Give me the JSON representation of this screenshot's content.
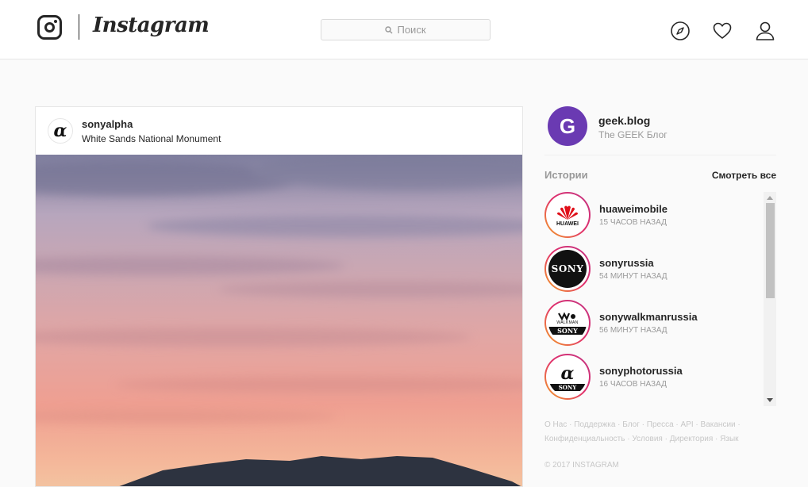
{
  "header": {
    "wordmark": "Instagram",
    "search_placeholder": "Поиск",
    "icons": [
      "instagram-logo-icon",
      "search-icon",
      "explore-compass-icon",
      "heart-icon",
      "profile-icon"
    ]
  },
  "post": {
    "username": "sonyalpha",
    "location": "White Sands National Monument",
    "avatar_glyph": "α"
  },
  "sidebar": {
    "me": {
      "initial": "G",
      "username": "geek.blog",
      "full_name": "The GEEK Блог"
    },
    "stories_title": "Истории",
    "see_all": "Смотреть все",
    "stories": [
      {
        "name": "huaweimobile",
        "time": "15 ЧАСОВ НАЗАД",
        "brand": "HUAWEI"
      },
      {
        "name": "sonyrussia",
        "time": "54 МИНУТ НАЗАД",
        "brand": "SONY"
      },
      {
        "name": "sonywalkmanrussia",
        "time": "56 МИНУТ НАЗАД",
        "brand": "WALKMAN",
        "brand2": "SONY"
      },
      {
        "name": "sonyphotorussia",
        "time": "16 ЧАСОВ НАЗАД",
        "brand": "α",
        "brand2": "SONY"
      }
    ],
    "footer_line1": "О Нас · Поддержка · Блог · Пресса · API · Вакансии ·",
    "footer_line2": "Конфиденциальность · Условия · Директория · Язык",
    "copyright": "© 2017 INSTAGRAM"
  },
  "colors": {
    "accent_avatar": "#6a3ab2",
    "story_ring": "#e1306c"
  }
}
